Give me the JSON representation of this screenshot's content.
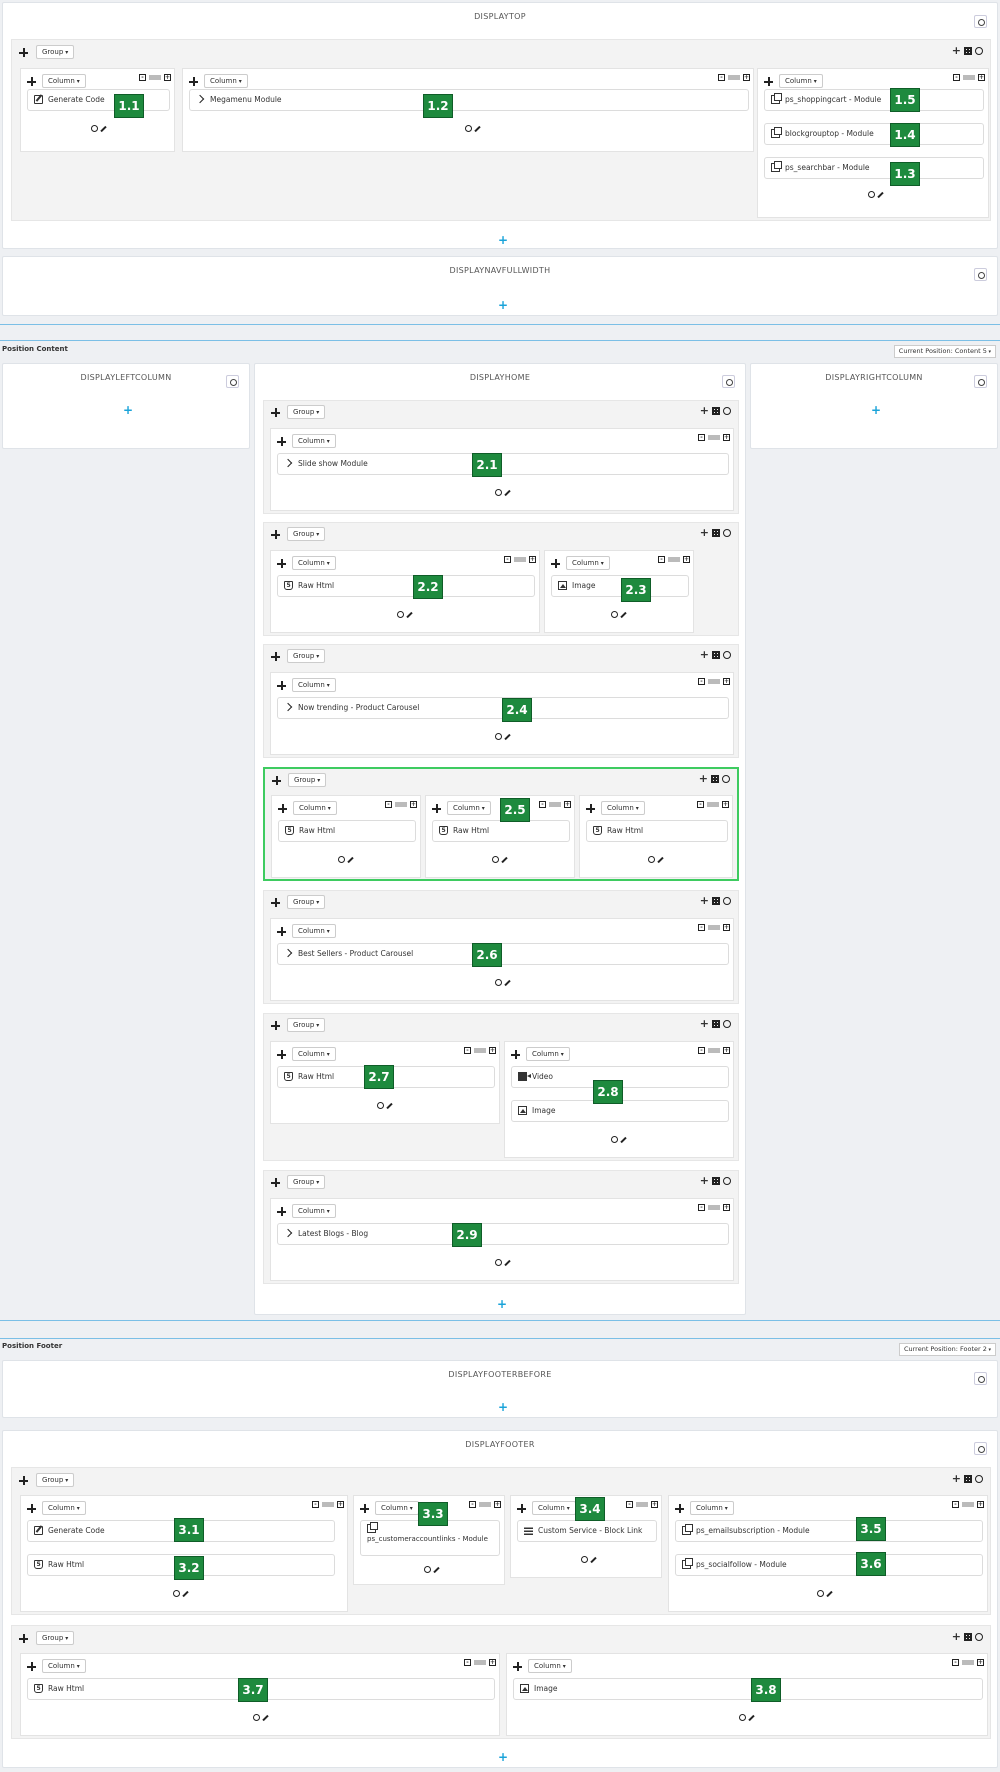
{
  "hooks": {
    "displaytop": "DISPLAYTOP",
    "displaynavfullwidth": "DISPLAYNAVFULLWIDTH",
    "displayleftcolumn": "DISPLAYLEFTCOLUMN",
    "displayhome": "DISPLAYHOME",
    "displayrightcolumn": "DISPLAYRIGHTCOLUMN",
    "displayfooterbefore": "DISPLAYFOOTERBEFORE",
    "displayfooter": "DISPLAYFOOTER"
  },
  "labels": {
    "group": "Group",
    "column": "Column",
    "add": "+"
  },
  "sections": {
    "content": "Position Content",
    "content_current": "Current Position: Content 5",
    "footer": "Position Footer",
    "footer_current": "Current Position: Footer 2"
  },
  "widgets": {
    "w1_1": "Generate Code",
    "w1_2": "Megamenu Module",
    "w1_5": "ps_shoppingcart - Module",
    "w1_4": "blockgrouptop - Module",
    "w1_3": "ps_searchbar - Module",
    "w2_1": "Slide show Module",
    "w2_2": "Raw Html",
    "w2_3": "Image",
    "w2_4": "Now trending - Product Carousel",
    "w2_5a": "Raw Html",
    "w2_5b": "Raw Html",
    "w2_5c": "Raw Html",
    "w2_6": "Best Sellers - Product Carousel",
    "w2_7": "Raw Html",
    "w2_8a": "Video",
    "w2_8b": "Image",
    "w2_9": "Latest Blogs - Blog",
    "w3_1": "Generate Code",
    "w3_2": "Raw Html",
    "w3_3": "ps_customeraccountlinks - Module",
    "w3_4": "Custom Service - Block Link",
    "w3_5": "ps_emailsubscription - Module",
    "w3_6": "ps_socialfollow - Module",
    "w3_7": "Raw Html",
    "w3_8": "Image"
  },
  "badges": {
    "b1_1": "1.1",
    "b1_2": "1.2",
    "b1_3": "1.3",
    "b1_4": "1.4",
    "b1_5": "1.5",
    "b2_1": "2.1",
    "b2_2": "2.2",
    "b2_3": "2.3",
    "b2_4": "2.4",
    "b2_5": "2.5",
    "b2_6": "2.6",
    "b2_7": "2.7",
    "b2_8": "2.8",
    "b2_9": "2.9",
    "b3_1": "3.1",
    "b3_2": "3.2",
    "b3_3": "3.3",
    "b3_4": "3.4",
    "b3_5": "3.5",
    "b3_6": "3.6",
    "b3_7": "3.7",
    "b3_8": "3.8"
  },
  "icons": [
    "move-icon",
    "settings-icon",
    "edit-icon",
    "plus-icon",
    "minus-icon",
    "grid-icon",
    "chevron-right-icon",
    "html5-icon",
    "image-icon",
    "video-icon",
    "module-icon",
    "list-icon"
  ]
}
